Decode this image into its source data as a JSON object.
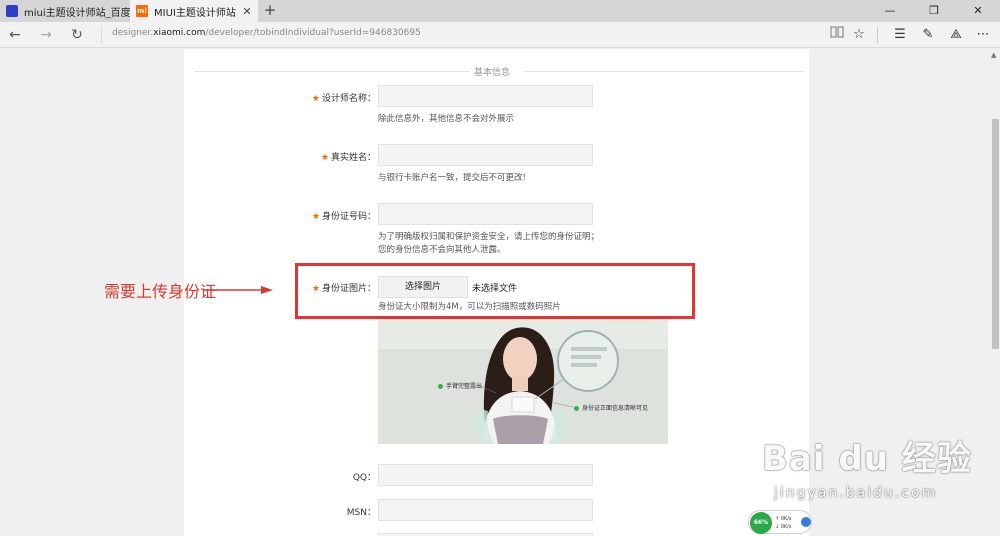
{
  "browser": {
    "tabs": [
      {
        "title": "miui主题设计师站_百度搜索",
        "icon": "baidu-paw-icon",
        "active": false
      },
      {
        "title": "MIUI主题设计师站",
        "icon": "mi-logo-icon",
        "favicon_text": "mi",
        "active": true
      }
    ],
    "new_tab": "+",
    "url": {
      "prefix": "designer.",
      "domain": "xiaomi.com",
      "path": "/developer/tobindIndividual?userId=946830695"
    }
  },
  "form": {
    "section_title": "基本信息",
    "fields": [
      {
        "label": "设计师名称：",
        "required": true,
        "value": "",
        "hint": "除此信息外，其他信息不会对外展示"
      },
      {
        "label": "真实姓名：",
        "required": true,
        "value": "",
        "hint": "与银行卡账户名一致，提交后不可更改!"
      },
      {
        "label": "身份证号码：",
        "required": true,
        "value": "",
        "hint_line1": "为了明确版权归属和保护资金安全，请上传您的身份证明；",
        "hint_line2": "您的身份信息不会向其他人泄露。"
      }
    ],
    "id_photo": {
      "label": "身份证图片：",
      "required": true,
      "button": "选择图片",
      "status": "未选择文件",
      "hint": "身份证大小限制为4M，可以为扫描照或数码照片"
    },
    "sample_image": {
      "annotation_left": "手臂完整露出",
      "annotation_right": "身份证正面信息清晰可见"
    },
    "qq": {
      "label": "QQ：",
      "value": ""
    },
    "msn": {
      "label": "MSN：",
      "value": ""
    }
  },
  "overlay": {
    "note": "需要上传身份证",
    "watermark_main": "Bai du 经验",
    "watermark_sub": "jingyan.baidu.com"
  },
  "netmon": {
    "percent": "66%",
    "up": "0K/s",
    "down": "0K/s"
  },
  "colors": {
    "required_star": "#ff6a00",
    "annotation_red": "#e8322d",
    "mi_orange": "#ff6700"
  }
}
